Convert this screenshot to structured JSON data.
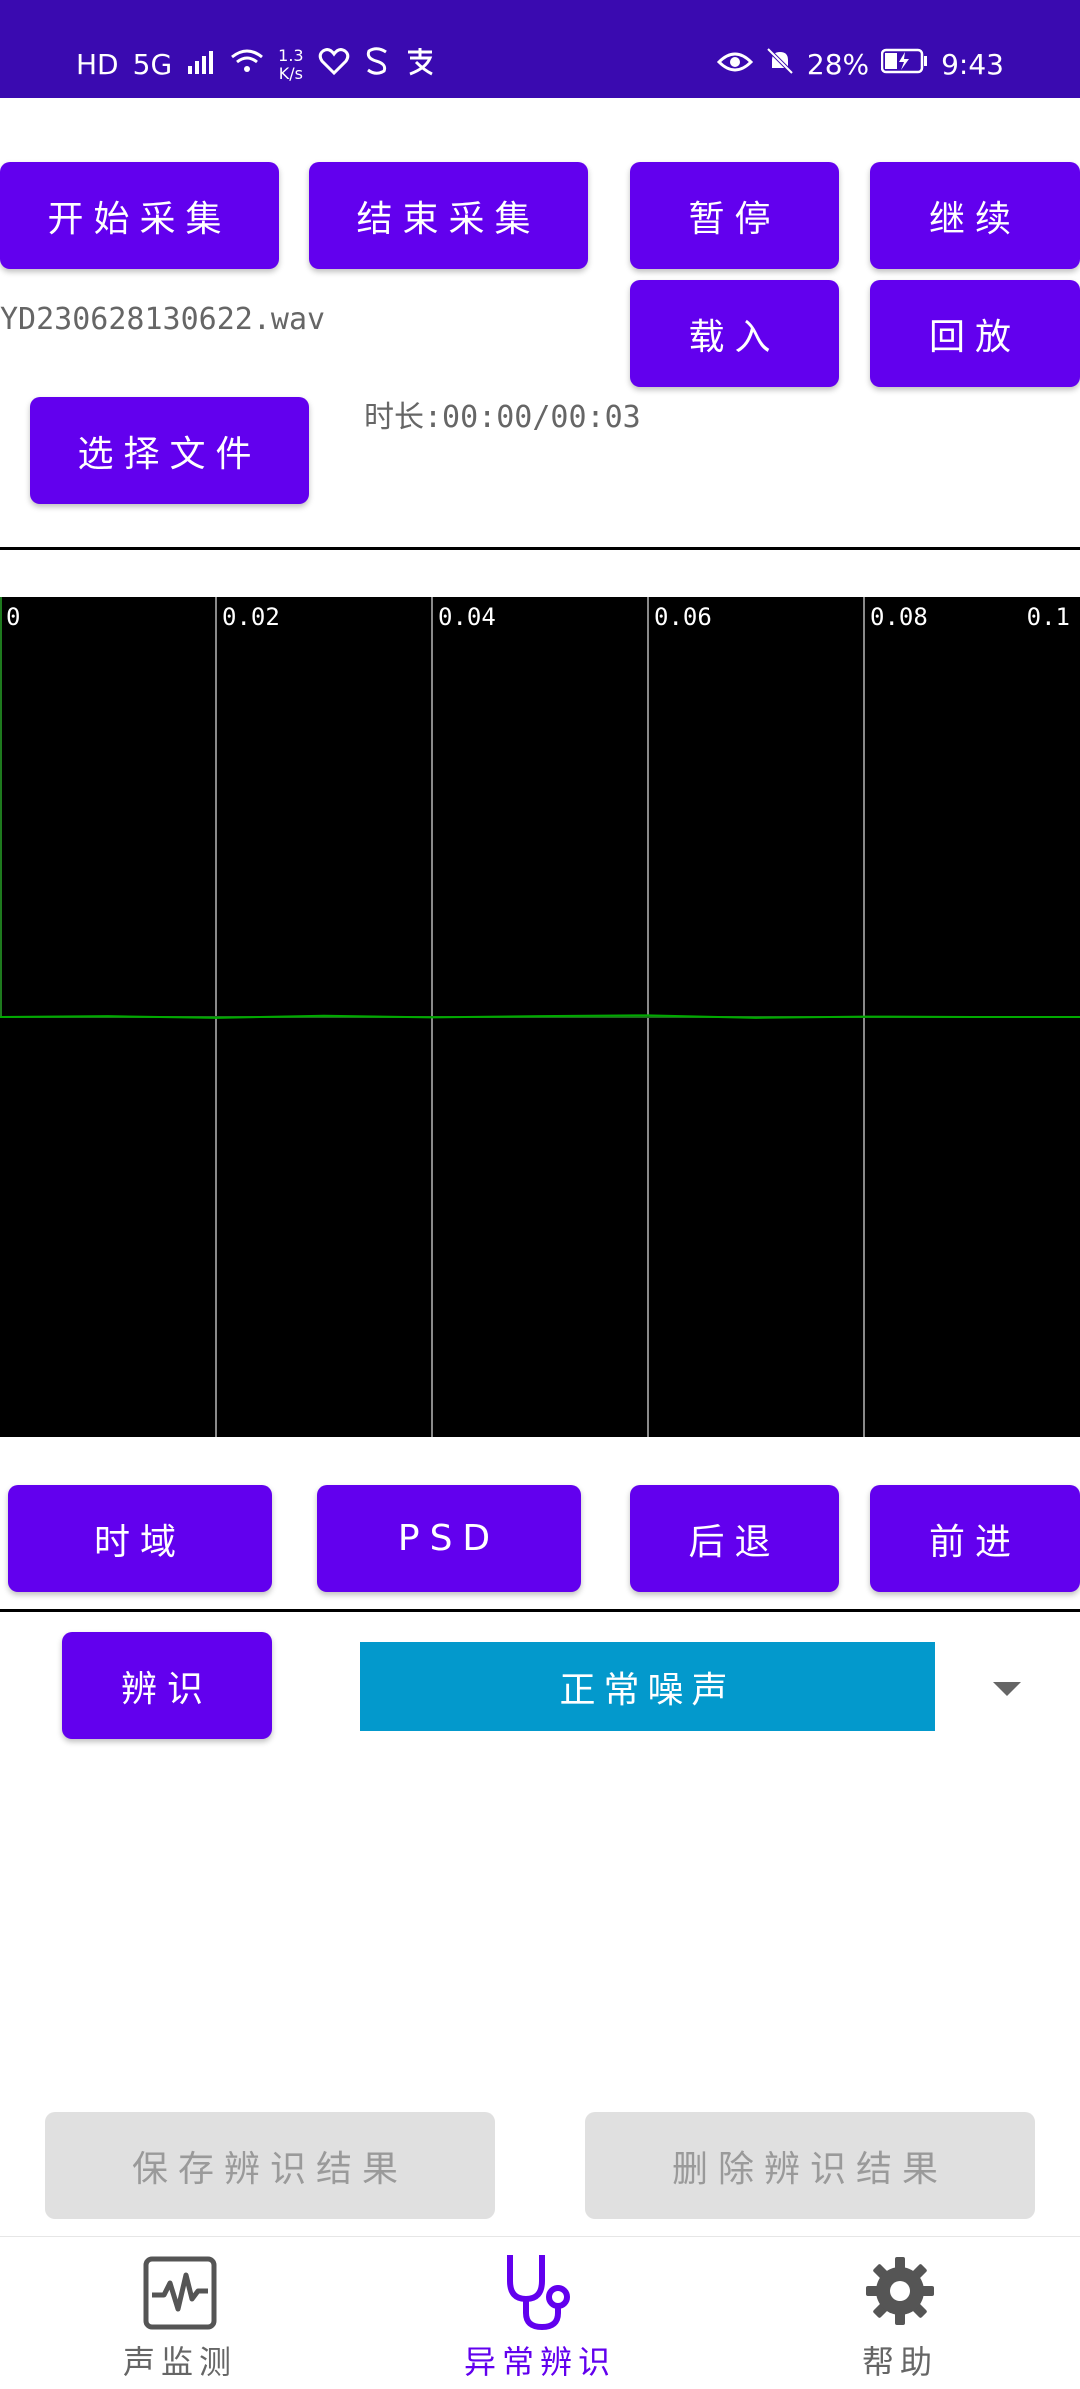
{
  "status_bar": {
    "left_icons": [
      "HD",
      "5G",
      "signal-bars-icon",
      "wifi-icon"
    ],
    "network_speed_value": "1.3",
    "network_speed_unit": "K/s",
    "app_icons": [
      "heart-icon",
      "s-icon",
      "pay-icon"
    ],
    "battery_percent": "28%",
    "time": "9:43"
  },
  "controls": {
    "start_label": "开始采集",
    "stop_label": "结束采集",
    "pause_label": "暂停",
    "continue_label": "继续",
    "load_label": "载入",
    "replay_label": "回放",
    "choose_file_label": "选择文件"
  },
  "file": {
    "name": "YD230628130622.wav",
    "duration_label": "时长:00:00/00:03"
  },
  "chart_data": {
    "type": "line",
    "x_ticks": [
      "0",
      "0.02",
      "0.04",
      "0.06",
      "0.08",
      "0.1"
    ],
    "xlim": [
      0,
      0.1
    ],
    "ylim": [
      -1,
      1
    ],
    "grid": true,
    "background": "#000000",
    "series": [
      {
        "color": "#00aa00",
        "x": [
          0,
          0.01,
          0.02,
          0.03,
          0.04,
          0.05,
          0.06,
          0.07,
          0.08,
          0.09,
          0.1
        ],
        "values": [
          0,
          0.002,
          -0.002,
          0.003,
          -0.001,
          0.002,
          0.004,
          -0.002,
          0.001,
          0,
          0
        ]
      }
    ]
  },
  "view_controls": {
    "time_domain_label": "时域",
    "psd_label": "PSD",
    "back_label": "后退",
    "forward_label": "前进"
  },
  "recognition": {
    "recognize_label": "辨识",
    "selected_result": "正常噪声",
    "save_label": "保存辨识结果",
    "delete_label": "删除辨识结果"
  },
  "bottom_nav": {
    "items": [
      {
        "label": "声监测",
        "icon": "waveform-monitor-icon",
        "active": false
      },
      {
        "label": "异常辨识",
        "icon": "stethoscope-icon",
        "active": true
      },
      {
        "label": "帮助",
        "icon": "gear-icon",
        "active": false
      }
    ]
  },
  "colors": {
    "primary": "#6200ee",
    "status_bar": "#3a0ab0",
    "select_bg": "#0399cc",
    "nav_active": "#6200ee",
    "nav_inactive": "#666666"
  }
}
